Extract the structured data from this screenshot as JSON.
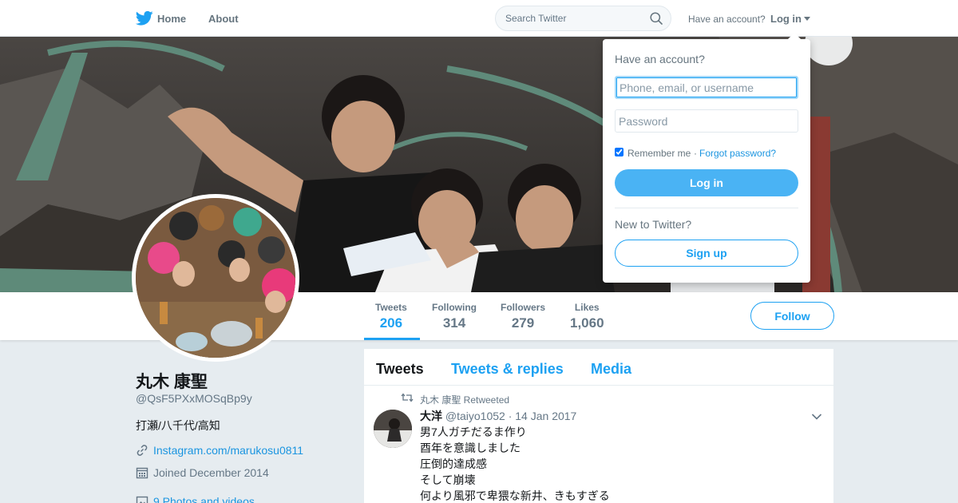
{
  "nav": {
    "home": "Home",
    "about": "About",
    "search_placeholder": "Search Twitter",
    "have_account": "Have an account?",
    "login": "Log in"
  },
  "profile": {
    "name": "丸木 康聖",
    "handle": "@QsF5PXxMOSqBp9y",
    "bio": "打瀬/八千代/高知",
    "link": "Instagram.com/marukosu0811",
    "joined": "Joined December 2014",
    "photos": "9 Photos and videos"
  },
  "stats": [
    {
      "label": "Tweets",
      "value": "206"
    },
    {
      "label": "Following",
      "value": "314"
    },
    {
      "label": "Followers",
      "value": "279"
    },
    {
      "label": "Likes",
      "value": "1,060"
    }
  ],
  "follow_label": "Follow",
  "timeline": {
    "tabs": [
      "Tweets",
      "Tweets & replies",
      "Media"
    ],
    "tweet": {
      "retweet_context": "丸木 康聖 Retweeted",
      "author_name": "大洋",
      "author_handle": "@taiyo1052",
      "date": "· 14 Jan 2017",
      "lines": [
        "男7人ガチだるま作り",
        "酉年を意識しました",
        "圧倒的達成感",
        "そして崩壊",
        "何より風邪で卑猥な新井、きもすぎる"
      ]
    }
  },
  "login_dropdown": {
    "title": "Have an account?",
    "username_placeholder": "Phone, email, or username",
    "password_placeholder": "Password",
    "remember": "Remember me",
    "separator": "·",
    "forgot": "Forgot password?",
    "login_button": "Log in",
    "new_to_twitter": "New to Twitter?",
    "signup_button": "Sign up"
  },
  "colors": {
    "accent": "#1da1f2",
    "login_button": "#4ab3f4",
    "page_background": "#e6ecf0"
  },
  "icons": [
    "twitter-bird-icon",
    "search-icon",
    "caret-down-icon",
    "link-icon",
    "calendar-icon",
    "photo-icon",
    "retweet-icon",
    "chevron-down-icon"
  ]
}
